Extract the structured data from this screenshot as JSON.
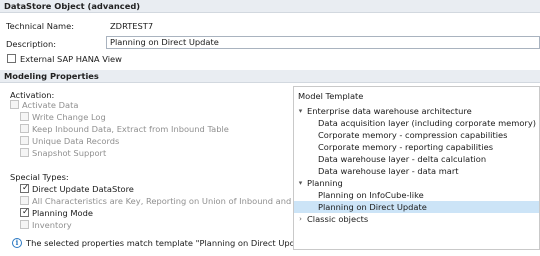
{
  "general": {
    "header": "DataStore Object (advanced)",
    "technical_name_label": "Technical Name:",
    "technical_name_value": "ZDRTEST7",
    "description_label": "Description:",
    "description_value": "Planning on Direct Update",
    "external_hana_label": "External SAP HANA View",
    "external_hana_checked": false
  },
  "modeling": {
    "header": "Modeling Properties",
    "activation_label": "Activation:",
    "activation_items": [
      {
        "label": "Activate Data",
        "checked": false,
        "enabled": false
      },
      {
        "label": "Write Change Log",
        "checked": false,
        "enabled": false
      },
      {
        "label": "Keep Inbound Data, Extract from Inbound Table",
        "checked": false,
        "enabled": false
      },
      {
        "label": "Unique Data Records",
        "checked": false,
        "enabled": false
      },
      {
        "label": "Snapshot Support",
        "checked": false,
        "enabled": false
      }
    ],
    "special_types_label": "Special Types:",
    "special_items": [
      {
        "label": "Direct Update DataStore",
        "checked": true,
        "enabled": true
      },
      {
        "label": "All Characteristics are Key, Reporting on Union of Inbound and Active Table",
        "checked": false,
        "enabled": false
      },
      {
        "label": "Planning Mode",
        "checked": true,
        "enabled": true
      },
      {
        "label": "Inventory",
        "checked": false,
        "enabled": false
      }
    ],
    "info_message": "The selected properties match template \"Planning on Direct Update\"."
  },
  "template_tree": {
    "title": "Model Template",
    "groups": [
      {
        "label": "Enterprise data warehouse architecture",
        "expanded": true,
        "children": [
          "Data acquisition layer (including corporate memory)",
          "Corporate memory - compression capabilities",
          "Corporate memory - reporting capabilities",
          "Data warehouse layer - delta calculation",
          "Data warehouse layer - data mart"
        ]
      },
      {
        "label": "Planning",
        "expanded": true,
        "children": [
          "Planning on InfoCube-like",
          "Planning on Direct Update"
        ]
      },
      {
        "label": "Classic objects",
        "expanded": false,
        "children": []
      }
    ],
    "selected_item": "Planning on Direct Update"
  },
  "icons": {
    "expanded": "chevron-down-icon",
    "collapsed": "chevron-right-icon",
    "info": "info-icon",
    "check": "checkmark-icon"
  },
  "colors": {
    "section_header_bg": "#e9edf2",
    "selection_bg": "#cce4f7",
    "info_blue": "#2b78c2"
  }
}
